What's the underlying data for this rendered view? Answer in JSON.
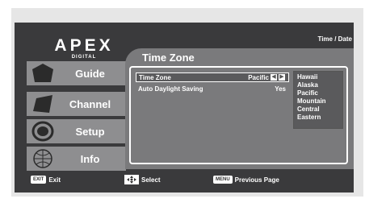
{
  "logo": {
    "brand": "APEX",
    "sub": "DIGITAL"
  },
  "header": {
    "datetime": "Time / Date"
  },
  "menu": [
    {
      "label": "Guide",
      "icon": "hexagon-icon"
    },
    {
      "label": "Channel",
      "icon": "parallelogram-icon"
    },
    {
      "label": "Setup",
      "icon": "ring-icon"
    },
    {
      "label": "Info",
      "icon": "globe-icon"
    }
  ],
  "panel": {
    "title": "Time Zone",
    "rows": [
      {
        "label": "Time Zone",
        "value": "Pacific",
        "selected": true
      },
      {
        "label": "Auto Daylight Saving",
        "value": "Yes",
        "selected": false
      }
    ]
  },
  "dropdown": {
    "options": [
      "Hawaii",
      "Alaska",
      "Pacific",
      "Mountain",
      "Central",
      "Eastern"
    ]
  },
  "footer": {
    "exit_key": "EXIT",
    "exit_label": "Exit",
    "select_label": "Select",
    "menu_key": "MENU",
    "previous_label": "Previous Page"
  },
  "colors": {
    "frame": "#3a3a3c",
    "menu_item": "#8e8e90",
    "panel": "#7a7a7c",
    "highlight": "#5a5a5c"
  }
}
